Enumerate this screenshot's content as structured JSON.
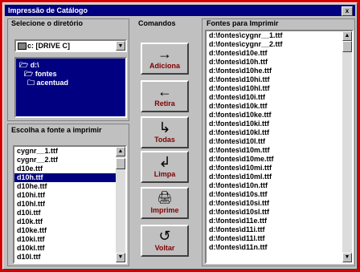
{
  "window": {
    "title": "Impressão de Catálogo",
    "close_label": "x"
  },
  "directory": {
    "label": "Selecione o diretório",
    "drive": "c: [DRIVE C]",
    "tree": [
      {
        "label": "d:\\"
      },
      {
        "label": "fontes"
      },
      {
        "label": "acentuad"
      }
    ]
  },
  "commands": {
    "label": "Comandos",
    "buttons": [
      {
        "label": "Adiciona",
        "icon": "→"
      },
      {
        "label": "Retira",
        "icon": "←"
      },
      {
        "label": "Todas",
        "icon": "↳"
      },
      {
        "label": "Limpa",
        "icon": "↲"
      },
      {
        "label": "Imprime",
        "icon": "🖨"
      },
      {
        "label": "Voltar",
        "icon": "↺"
      }
    ]
  },
  "fonts": {
    "label": "Escolha a fonte a imprimir",
    "items": [
      "cygnr__1.ttf",
      "cygnr__2.ttf",
      "d10e.ttf",
      "d10h.ttf",
      "d10he.ttf",
      "d10hi.ttf",
      "d10hl.ttf",
      "d10i.ttf",
      "d10k.ttf",
      "d10ke.ttf",
      "d10ki.ttf",
      "d10kl.ttf",
      "d10l.ttf"
    ],
    "selected": 3
  },
  "print_list": {
    "label": "Fontes para Imprimir",
    "items": [
      "d:\\fontes\\cygnr__1.ttf",
      "d:\\fontes\\cygnr__2.ttf",
      "d:\\fontes\\d10e.ttf",
      "d:\\fontes\\d10h.ttf",
      "d:\\fontes\\d10he.ttf",
      "d:\\fontes\\d10hi.ttf",
      "d:\\fontes\\d10hl.ttf",
      "d:\\fontes\\d10i.ttf",
      "d:\\fontes\\d10k.ttf",
      "d:\\fontes\\d10ke.ttf",
      "d:\\fontes\\d10ki.ttf",
      "d:\\fontes\\d10kl.ttf",
      "d:\\fontes\\d10l.ttf",
      "d:\\fontes\\d10m.ttf",
      "d:\\fontes\\d10me.ttf",
      "d:\\fontes\\d10mi.ttf",
      "d:\\fontes\\d10ml.ttf",
      "d:\\fontes\\d10n.ttf",
      "d:\\fontes\\d10s.ttf",
      "d:\\fontes\\d10si.ttf",
      "d:\\fontes\\d10sl.ttf",
      "d:\\fontes\\d11e.ttf",
      "d:\\fontes\\d11i.ttf",
      "d:\\fontes\\d11l.ttf",
      "d:\\fontes\\d11n.ttf"
    ]
  }
}
